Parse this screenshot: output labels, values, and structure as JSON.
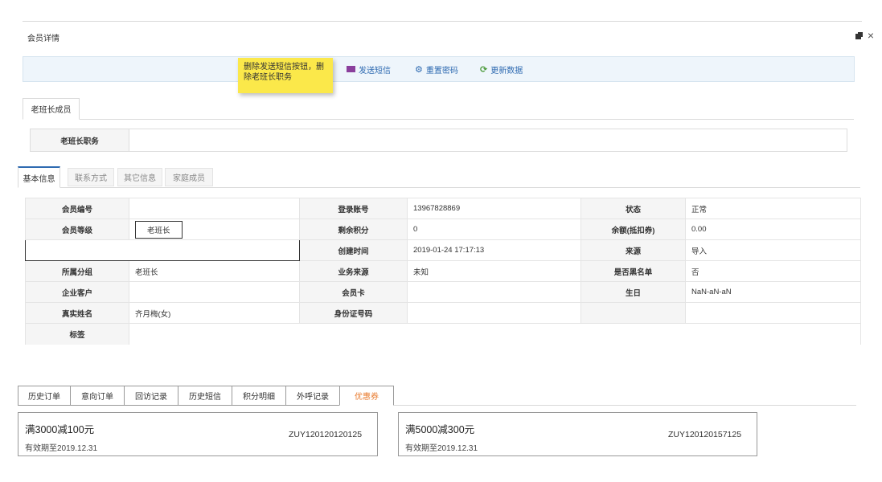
{
  "window": {
    "title": "会员详情",
    "restore_icon": "restore-window-icon",
    "close_icon": "×"
  },
  "toolbar": {
    "sms_label": "发送短信",
    "reset_label": "重置密码",
    "refresh_label": "更新数据",
    "tooltip": "删除发送短信按钮，删除老班长职务"
  },
  "section_tab": {
    "label": "老班长成员"
  },
  "position_field": {
    "label": "老班长职务",
    "value": ""
  },
  "info_tabs": [
    "基本信息",
    "联系方式",
    "其它信息",
    "家庭成员"
  ],
  "info": {
    "member_no_label": "会员编号",
    "member_no": "",
    "login_label": "登录账号",
    "login": "13967828869",
    "status_label": "状态",
    "status": "正常",
    "level_label": "会员等级",
    "level": "老班长",
    "points_label": "剩余积分",
    "points": "0",
    "balance_label": "余额(抵扣券)",
    "balance": "0.00",
    "created_label": "创建时间",
    "created": "2019-01-24 17:17:13",
    "source_label": "来源",
    "source": "导入",
    "group_label": "所属分组",
    "group": "老班长",
    "biz_source_label": "业务来源",
    "biz_source": "未知",
    "blacklist_label": "是否黑名单",
    "blacklist": "否",
    "company_label": "企业客户",
    "company": "",
    "card_label": "会员卡",
    "card": "",
    "birthday_label": "生日",
    "birthday": "NaN-aN-aN",
    "realname_label": "真实姓名",
    "realname": "齐月梅(女)",
    "idcard_label": "身份证号码",
    "idcard": "",
    "tags_label": "标签",
    "tags": ""
  },
  "bottom_tabs": [
    {
      "label": "历史订单"
    },
    {
      "label": "意向订单"
    },
    {
      "label": "回访记录"
    },
    {
      "label": "历史短信"
    },
    {
      "label": "积分明细"
    },
    {
      "label": "外呼记录"
    },
    {
      "label": "优惠券"
    }
  ],
  "active_tab_color": "#e8782a",
  "coupons": [
    {
      "title": "满3000减100元",
      "expiry": "有效期至2019.12.31",
      "code": "ZUY120120120125"
    },
    {
      "title": "满5000减300元",
      "expiry": "有效期至2019.12.31",
      "code": "ZUY120120157125"
    }
  ]
}
